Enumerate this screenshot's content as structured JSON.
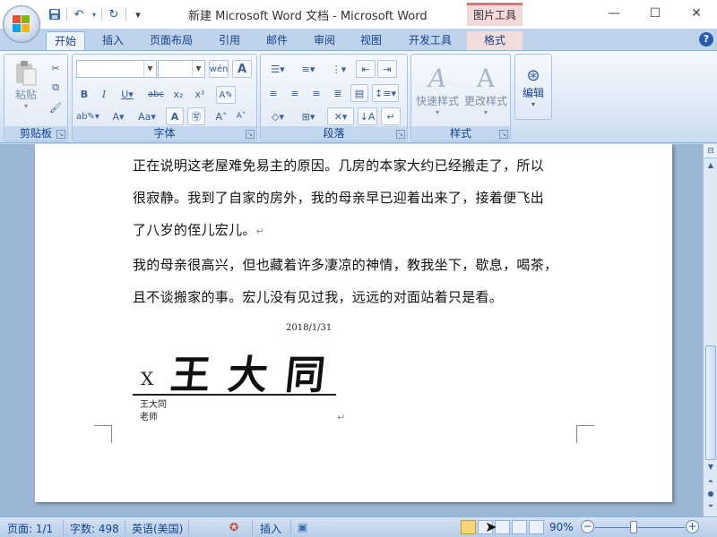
{
  "window": {
    "title": "新建 Microsoft Word 文档 - Microsoft Word",
    "context_tab_header": "图片工具",
    "controls": {
      "minimize": "—",
      "maximize": "☐",
      "close": "✕"
    }
  },
  "quick_access": {
    "save": "💾",
    "undo": "↶",
    "redo": "↻",
    "customize": "▾"
  },
  "tabs": [
    "开始",
    "插入",
    "页面布局",
    "引用",
    "邮件",
    "审阅",
    "视图",
    "开发工具",
    "格式"
  ],
  "active_tab": "开始",
  "help": "?",
  "ribbon": {
    "clipboard": {
      "label": "剪贴板",
      "paste": "粘贴"
    },
    "font": {
      "label": "字体",
      "font_name": "",
      "font_size": ""
    },
    "paragraph": {
      "label": "段落"
    },
    "styles": {
      "label": "样式",
      "quick_styles": "快速样式",
      "change_styles": "更改样式"
    },
    "editing": {
      "label": "编辑"
    }
  },
  "document": {
    "paragraphs": [
      "正在说明这老屋难免易主的原因。几房的本家大约已经搬走了，所以",
      "很寂静。我到了自家的房外，我的母亲早已迎着出来了，接着便飞出",
      "了八岁的侄儿宏儿。",
      "我的母亲很高兴，但也藏着许多凄凉的神情，教我坐下，歇息，喝茶，",
      "且不谈搬家的事。宏儿没有见过我，远远的对面站着只是看。"
    ],
    "paragraph_mark": "↵",
    "signature": {
      "date": "2018/1/31",
      "x_mark": "X",
      "name_image": "王大同",
      "signer_name": "王大同",
      "signer_title": "老师"
    }
  },
  "statusbar": {
    "page": "页面: 1/1",
    "words": "字数: 498",
    "language": "英语(美国)",
    "insert_mode": "插入",
    "zoom": "90%",
    "zoom_minus": "−",
    "zoom_plus": "+",
    "zoom_level": 0.5
  },
  "colors": {
    "ribbon_accent": "#15428b",
    "context_tab": "#d07a7a",
    "page_bg": "#ffffff",
    "workspace_bg": "#9cb6d6"
  }
}
